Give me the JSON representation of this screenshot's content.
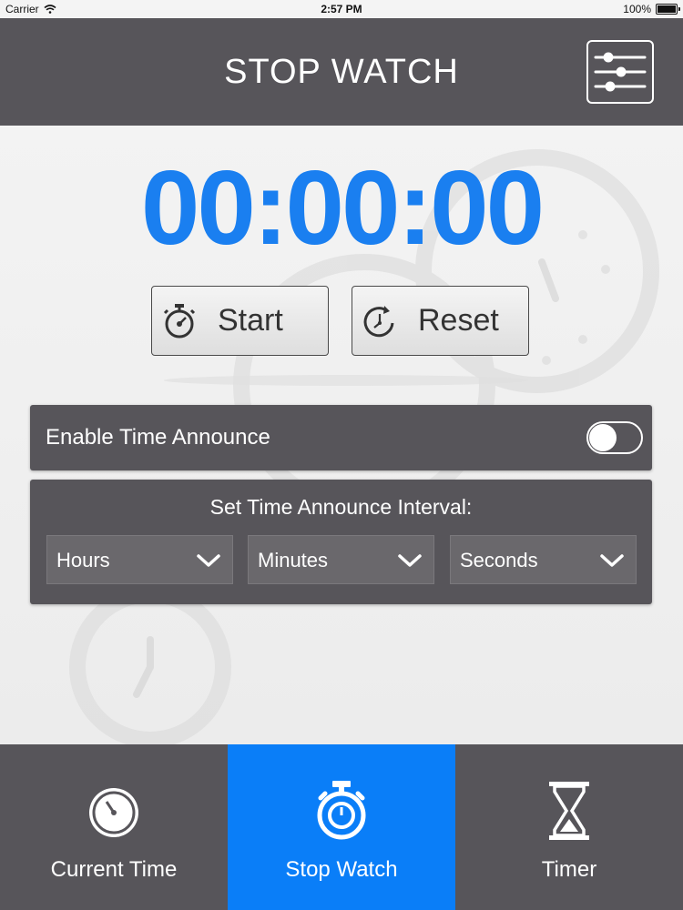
{
  "status_bar": {
    "carrier": "Carrier",
    "time": "2:57 PM",
    "battery": "100%"
  },
  "header": {
    "title": "STOP WATCH"
  },
  "stopwatch": {
    "display": "00:00:00"
  },
  "buttons": {
    "start": "Start",
    "reset": "Reset"
  },
  "announce": {
    "label": "Enable Time Announce",
    "enabled": false
  },
  "interval": {
    "title": "Set Time Announce Interval:",
    "hours": "Hours",
    "minutes": "Minutes",
    "seconds": "Seconds"
  },
  "tabs": [
    {
      "label": "Current Time",
      "icon": "clock-icon",
      "active": false
    },
    {
      "label": "Stop Watch",
      "icon": "stopwatch-icon",
      "active": true
    },
    {
      "label": "Timer",
      "icon": "hourglass-icon",
      "active": false
    }
  ],
  "colors": {
    "accent": "#1a7ff0",
    "tab_active": "#0a7ef8",
    "panel": "#57555a"
  }
}
